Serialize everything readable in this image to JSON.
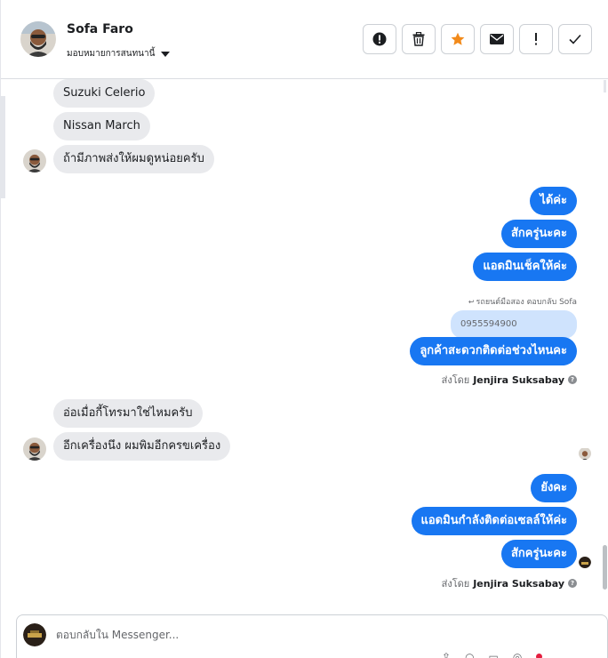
{
  "header": {
    "contact_name": "Sofa Faro",
    "assign_label": "มอบหมายการสนทนานี้",
    "actions": [
      {
        "name": "report-icon",
        "glyph": "!"
      },
      {
        "name": "trash-icon",
        "glyph": "🗑"
      },
      {
        "name": "star-icon",
        "glyph": "★"
      },
      {
        "name": "mail-icon",
        "glyph": "✉"
      },
      {
        "name": "follow-up-icon",
        "glyph": "!"
      },
      {
        "name": "check-icon",
        "glyph": "✓"
      }
    ]
  },
  "messages": {
    "in_1": "Suzuki Celerio",
    "in_2": "Nissan March",
    "in_3": "ถ้ามีภาพส่งให้ผมดูหน่อยครับ",
    "out_1": "ได้ค่ะ",
    "out_2": "สักครู่นะคะ",
    "out_3": "แอดมินเช็คให้ค่ะ",
    "reply_label": "รถยนต์มือสอง ตอบกลับ Sofa",
    "reply_quote": "0955594900",
    "out_4": "ลูกค้าสะดวกติดต่อช่วงไหนคะ",
    "in_4": "อ่อเมื่อกี้โทรมาใช่ไหมครับ",
    "in_5": "อีกเครื่องนึง ผมพิมอีกครขเครื่อง",
    "out_5": "ยังคะ",
    "out_6": "แอดมินกำลังติดต่อเซลล์ให้ค่ะ",
    "out_7": "สักครู่นะคะ"
  },
  "sent_by": {
    "prefix": "ส่งโดย",
    "agent": "Jenjira Suksabay",
    "help": "?"
  },
  "composer": {
    "placeholder": "ตอบกลับใน Messenger..."
  },
  "colors": {
    "outgoing": "#1877f2",
    "incoming": "#e9eaed",
    "star": "#f28a1a"
  }
}
